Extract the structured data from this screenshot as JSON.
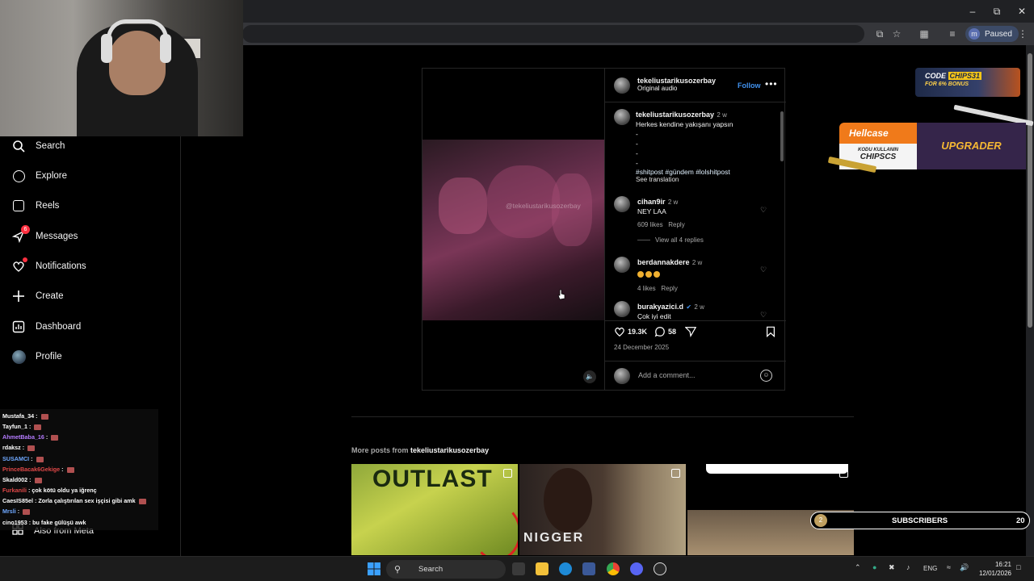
{
  "browser": {
    "profile_initial": "m",
    "profile_status": "Paused"
  },
  "sidebar": {
    "items": [
      {
        "label": "Search",
        "icon": "search-icon"
      },
      {
        "label": "Explore",
        "icon": "compass-icon"
      },
      {
        "label": "Reels",
        "icon": "reels-icon"
      },
      {
        "label": "Messages",
        "icon": "messenger-icon",
        "badge": "6"
      },
      {
        "label": "Notifications",
        "icon": "heart-icon"
      },
      {
        "label": "Create",
        "icon": "plus-icon"
      },
      {
        "label": "Dashboard",
        "icon": "dashboard-icon"
      },
      {
        "label": "Profile",
        "icon": "avatar-icon"
      }
    ],
    "also_from_meta": "Also from Meta"
  },
  "chat": [
    {
      "user": "Mustafa_34",
      "msg": "",
      "color": "#ffffff"
    },
    {
      "user": "Tayfun_1",
      "msg": "",
      "color": "#ffffff"
    },
    {
      "user": "AhmetBaba_16",
      "msg": "",
      "color": "#b57cff"
    },
    {
      "user": "rdaksz",
      "msg": "",
      "color": "#ffffff"
    },
    {
      "user": "SUSAMCI",
      "msg": "",
      "color": "#6fa8ff"
    },
    {
      "user": "PrinceBacak6Gekige",
      "msg": "",
      "color": "#e04848"
    },
    {
      "user": "Skald002",
      "msg": "",
      "color": "#ffffff"
    },
    {
      "user": "Furkanili",
      "msg": "çok kötü oldu ya iğrenç",
      "color": "#e04848"
    },
    {
      "user": "CaesIS85el",
      "msg": "Zorla çalıştırılan sex işçisi gibi amk",
      "color": "#ffffff"
    },
    {
      "user": "Mrsli",
      "msg": "",
      "color": "#6fa8ff"
    },
    {
      "user": "cino1953",
      "msg": "bu fake gülüşü awk",
      "color": "#ffffff"
    }
  ],
  "post": {
    "author": "tekeliustarikusozerbay",
    "audio": "Original audio",
    "follow": "Follow",
    "watermark": "@tekeliustarikusozerbay",
    "caption": {
      "user": "tekeliustarikusozerbay",
      "time": "2 w",
      "text": "Herkes kendine yakışanı yapsın",
      "dashes": [
        "-",
        "-",
        "-",
        "-"
      ],
      "hashtags": "#shitpost #gündem #lolshitpost",
      "see_translation": "See translation"
    },
    "comments": [
      {
        "user": "cihan9ir",
        "time": "2 w",
        "text": "NEY LAA",
        "likes": "609 likes",
        "reply": "Reply",
        "view_replies": "View all 4 replies"
      },
      {
        "user": "berdannakdere",
        "time": "2 w",
        "text": "",
        "emoji_count": 3,
        "likes": "4 likes",
        "reply": "Reply"
      },
      {
        "user": "burakyazici.d",
        "time": "2 w",
        "text": "Çok iyi edit",
        "verified": true
      }
    ],
    "like_count": "19.3K",
    "comment_count": "58",
    "date": "24 December 2025",
    "add_comment_placeholder": "Add a comment..."
  },
  "more_posts": {
    "prefix": "More posts from",
    "user": "tekeliustarikusozerbay",
    "thumbs": [
      {
        "text": "OUTLAST"
      },
      {
        "text": "NIGGER"
      },
      {
        "text": ""
      }
    ]
  },
  "overlays": {
    "code_banner_line1": "CODE",
    "code_banner_code": "CHIPS31",
    "code_banner_line2": "FOR 6% BONUS",
    "hellcase_brand": "Hellcase",
    "hellcase_small": "KODU KULLANIN",
    "hellcase_code": "CHIPSCS",
    "hellcase_upgrader": "UPGRADER",
    "subs_num": "2",
    "subs_label": "SUBSCRIBERS",
    "subs_count": "20"
  },
  "taskbar": {
    "search": "Search",
    "lang": "ENG",
    "time": "16:21",
    "date": "12/01/2026"
  },
  "colors": {
    "link_blue": "#4192ef",
    "notification_red": "#ff3040",
    "hellcase_orange": "#f07a1a"
  }
}
